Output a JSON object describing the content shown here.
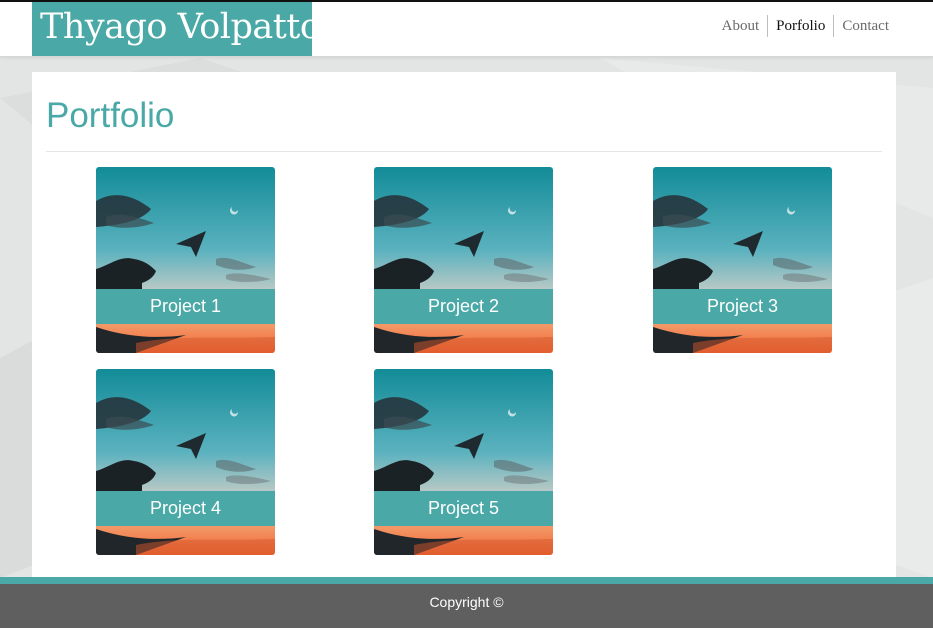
{
  "header": {
    "logo_text": "Thyago Volpatto",
    "nav": [
      "About",
      "Porfolio",
      "Contact"
    ],
    "active_nav": "Porfolio"
  },
  "main": {
    "title": "Portfolio",
    "projects": [
      {
        "label": "Project 1"
      },
      {
        "label": "Project 2"
      },
      {
        "label": "Project 3"
      },
      {
        "label": "Project 4"
      },
      {
        "label": "Project 5"
      }
    ]
  },
  "footer": {
    "text": "Copyright ©"
  },
  "colors": {
    "accent": "#4aa8a6",
    "footer_bg": "#5f5f5f",
    "page_bg": "#e3e4e4"
  }
}
